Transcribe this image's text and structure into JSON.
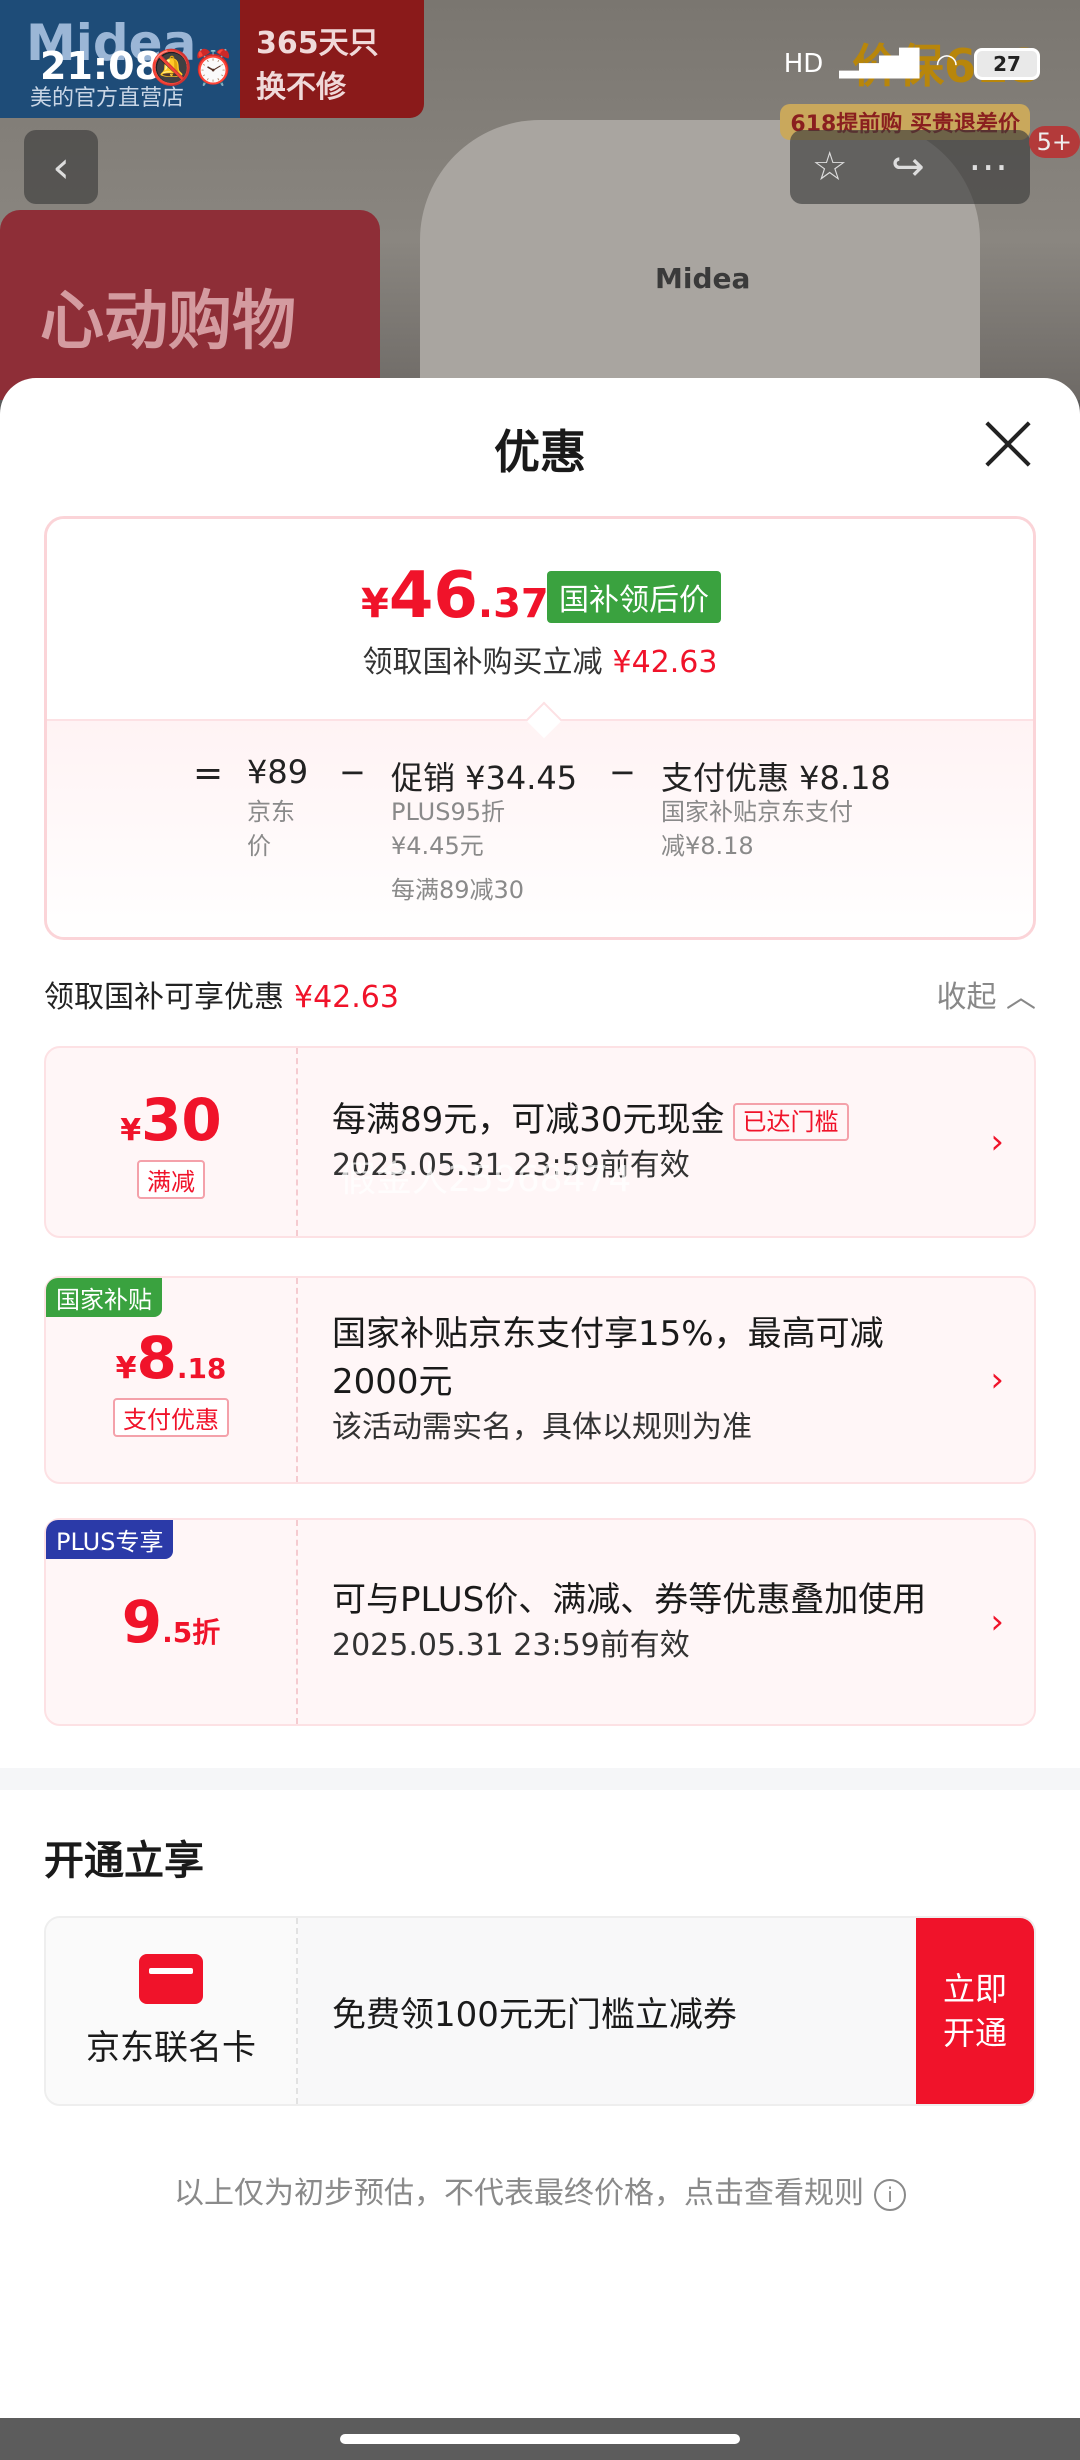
{
  "status": {
    "time": "21:08",
    "notif_icons": "🔕⏰",
    "net": "HD",
    "battery": "27"
  },
  "background": {
    "brand_logo": "Midea",
    "brand_sub": "美的官方直营店",
    "badge_365": "365天只换不修",
    "promo": "心动购物季",
    "kettle_logo": "Midea",
    "jiabao": "价保618",
    "jiabao_sub": "618提前购 买贵退差价",
    "nav_badge": "5+"
  },
  "sheet": {
    "title": "优惠"
  },
  "price": {
    "yen": "¥",
    "int": "46",
    "dec": ".37",
    "tag": "国补领后价",
    "sub_prefix": "领取国补购买立减",
    "sub_amount": "¥42.63",
    "breakdown": {
      "eq": "=",
      "base": "¥89",
      "base_label": "京东价",
      "minus1": "−",
      "promo_title": "促销 ¥34.45",
      "promo_l1": "PLUS95折",
      "promo_l2": "¥4.45元",
      "promo_l3": "每满89减30",
      "minus2": "−",
      "pay_title": "支付优惠 ¥8.18",
      "pay_l1": "国家补贴京东支付",
      "pay_l2": "减¥8.18"
    }
  },
  "section": {
    "title": "领取国补可享优惠",
    "amount": "¥42.63",
    "collapse": "收起 ︿"
  },
  "coupons": [
    {
      "yen": "¥",
      "int": "30",
      "dec": "",
      "type": "满减",
      "flag": "",
      "main": "每满89元，可减30元现金",
      "reached": "已达门槛",
      "sub": "2025.05.31 23:59前有效"
    },
    {
      "yen": "¥",
      "int": "8",
      "dec": ".18",
      "type": "支付优惠",
      "flag": "国家补贴",
      "main": "国家补贴京东支付享15%，最高可减2000元",
      "sub": "该活动需实名，具体以规则为准"
    },
    {
      "yen": "",
      "int": "9",
      "dec": ".5折",
      "type": "",
      "flag": "PLUS专享",
      "main": "可与PLUS价、满减、券等优惠叠加使用",
      "sub": "2025.05.31 23:59前有效"
    }
  ],
  "watermark": "假金人25968474",
  "open": {
    "title": "开通立享",
    "card_name": "京东联名卡",
    "text": "免费领100元无门槛立减券",
    "btn": "立即开通"
  },
  "footnote": "以上仅为初步预估，不代表最终价格，点击查看规则",
  "colors": {
    "accent": "#f0132a",
    "green_tag": "#3aa23f",
    "plus_blue": "#2b3aa8"
  }
}
